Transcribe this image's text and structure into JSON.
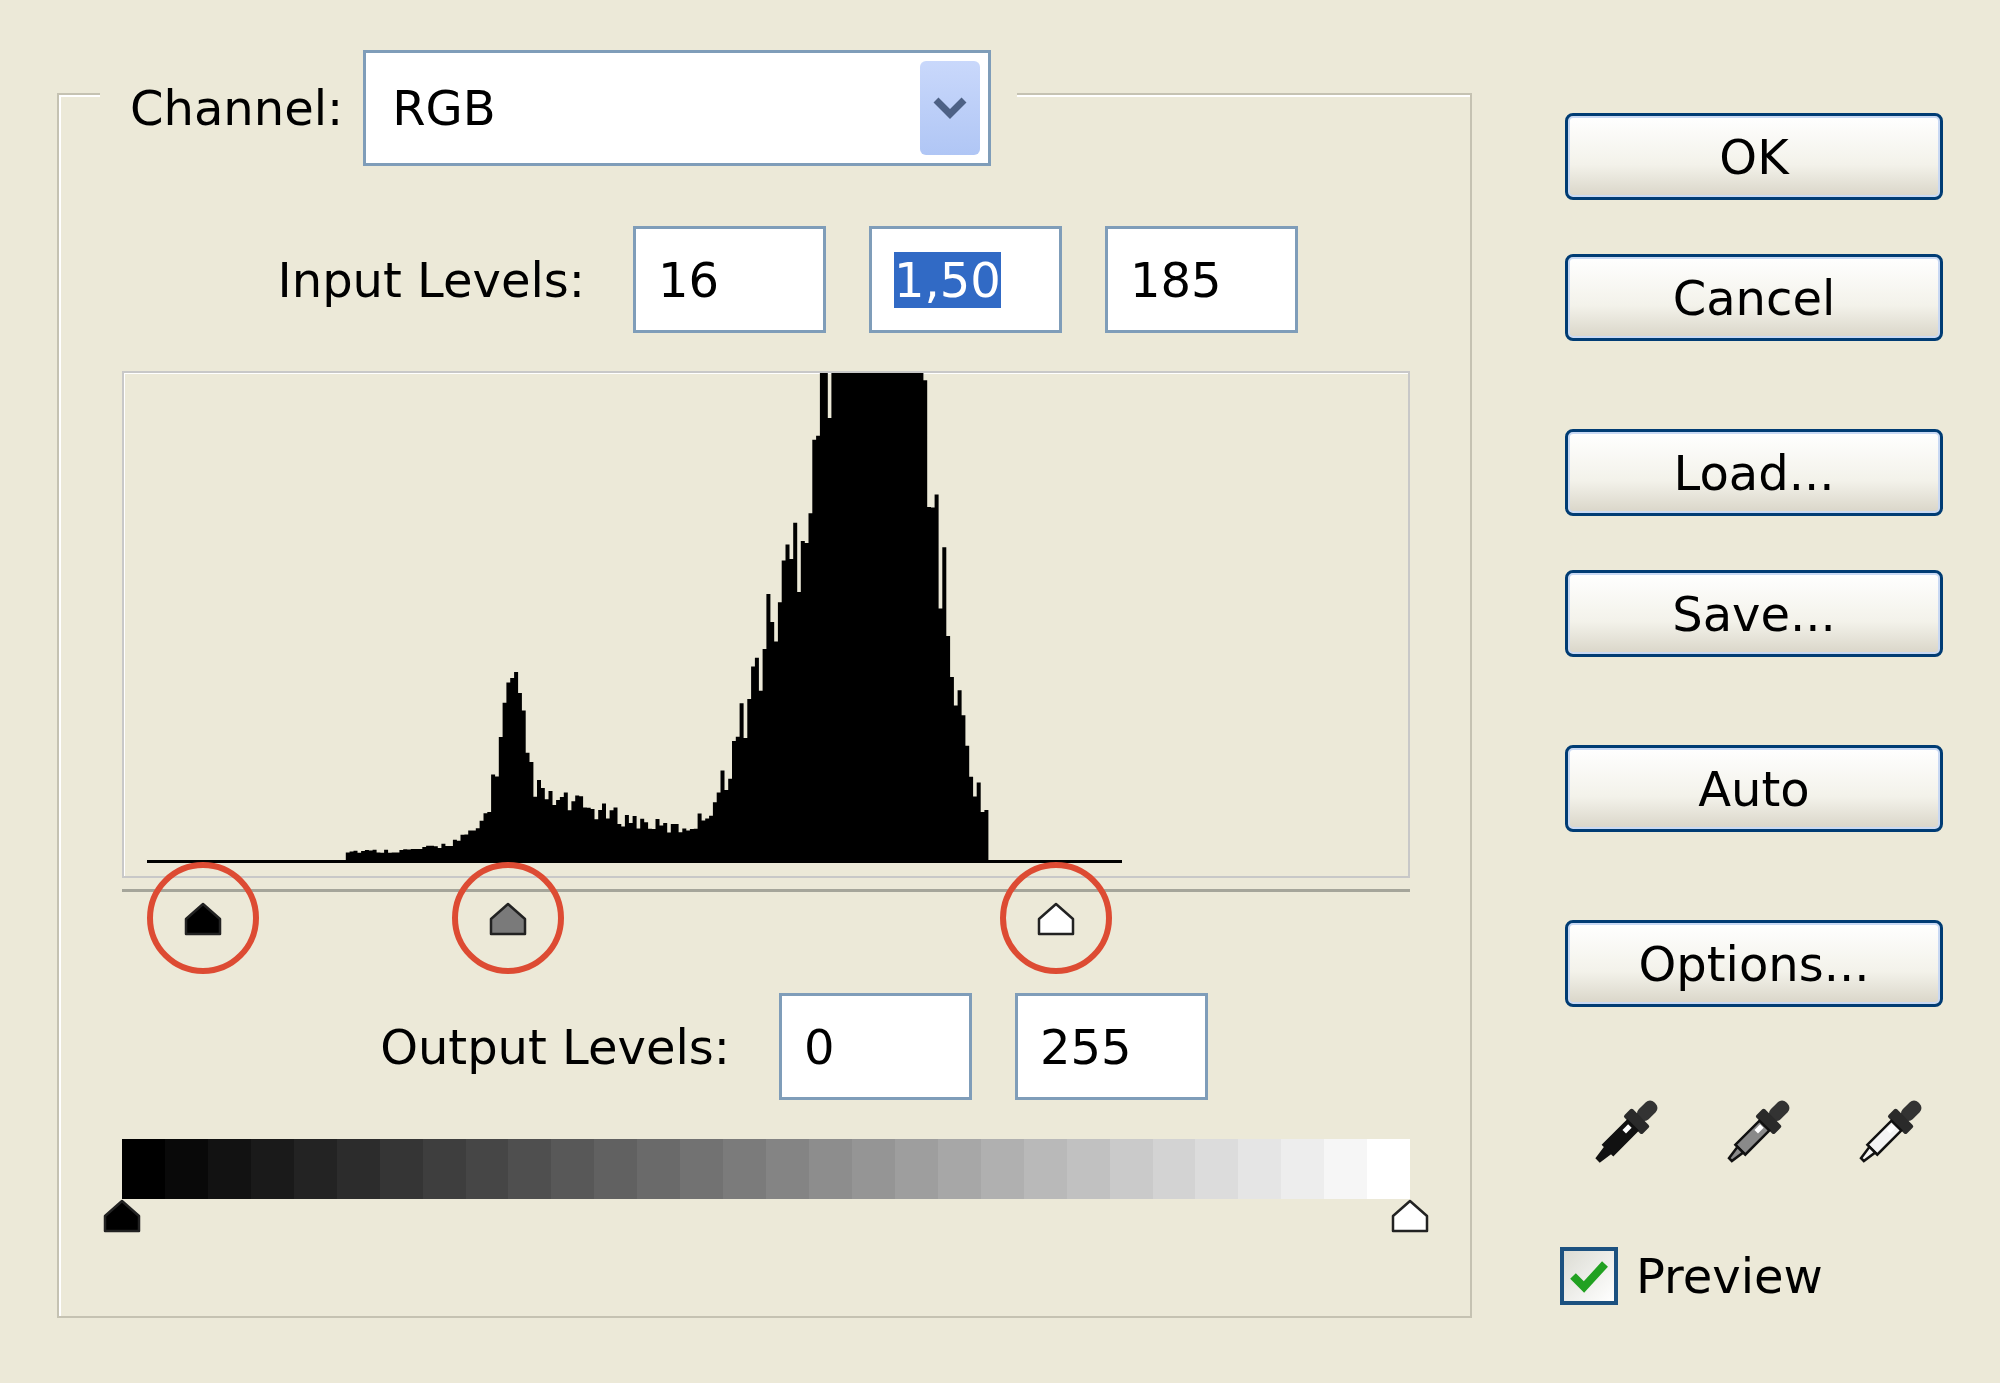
{
  "channel": {
    "label": "Channel:",
    "value": "RGB"
  },
  "input_levels": {
    "label": "Input Levels:",
    "fields": [
      {
        "value": "16",
        "selected": false
      },
      {
        "value": "1,50",
        "selected": true
      },
      {
        "value": "185",
        "selected": false
      }
    ],
    "sliders": [
      {
        "kind": "black",
        "level": 0.063,
        "highlighted": true
      },
      {
        "kind": "gray",
        "level": 0.3,
        "highlighted": true
      },
      {
        "kind": "white",
        "level": 0.725,
        "highlighted": true
      }
    ]
  },
  "output_levels": {
    "label": "Output Levels:",
    "fields": [
      {
        "value": "0"
      },
      {
        "value": "255"
      }
    ],
    "sliders": [
      {
        "kind": "black",
        "level": 0
      },
      {
        "kind": "white",
        "level": 1
      }
    ]
  },
  "buttons": [
    {
      "label": "OK"
    },
    {
      "label": "Cancel"
    },
    {
      "label": "Load..."
    },
    {
      "label": "Save..."
    },
    {
      "label": "Auto"
    },
    {
      "label": "Options..."
    }
  ],
  "eyedroppers": [
    {
      "kind": "black"
    },
    {
      "kind": "gray"
    },
    {
      "kind": "white"
    }
  ],
  "preview": {
    "label": "Preview",
    "checked": true
  }
}
